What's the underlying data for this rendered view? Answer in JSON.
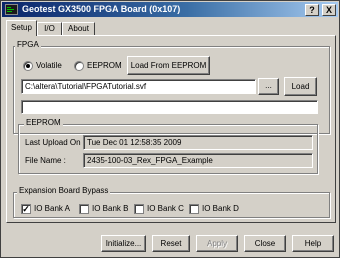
{
  "window": {
    "title": "Geotest GX3500 FPGA Board (0x107)",
    "help_glyph": "?",
    "close_glyph": "X",
    "accent_color": "#0a246a"
  },
  "tabs": [
    {
      "label": "Setup",
      "active": true
    },
    {
      "label": "I/O",
      "active": false
    },
    {
      "label": "About",
      "active": false
    }
  ],
  "fpga": {
    "group_label": "FPGA",
    "volatile_label": "Volatile",
    "eeprom_label": "EEPROM",
    "selected": "Volatile",
    "load_from_eeprom_label": "Load From EEPROM",
    "path_value": "C:\\altera\\Tutorial\\FPGATutorial.svf",
    "browse_label": "...",
    "load_label": "Load",
    "progress": 0
  },
  "eeprom": {
    "group_label": "EEPROM",
    "last_upload_label": "Last Upload On :",
    "last_upload_value": "Tue Dec 01 12:58:35 2009",
    "file_name_label": "File Name :",
    "file_name_value": "2435-100-03_Rex_FPGA_Example"
  },
  "bypass": {
    "group_label": "Expansion Board Bypass",
    "banks": [
      {
        "label": "IO Bank A",
        "checked": true
      },
      {
        "label": "IO Bank B",
        "checked": false
      },
      {
        "label": "IO Bank C",
        "checked": false
      },
      {
        "label": "IO Bank D",
        "checked": false
      }
    ]
  },
  "footer": {
    "initialize_label": "Initialize...",
    "reset_label": "Reset",
    "apply_label": "Apply",
    "close_label": "Close",
    "help_label": "Help"
  }
}
